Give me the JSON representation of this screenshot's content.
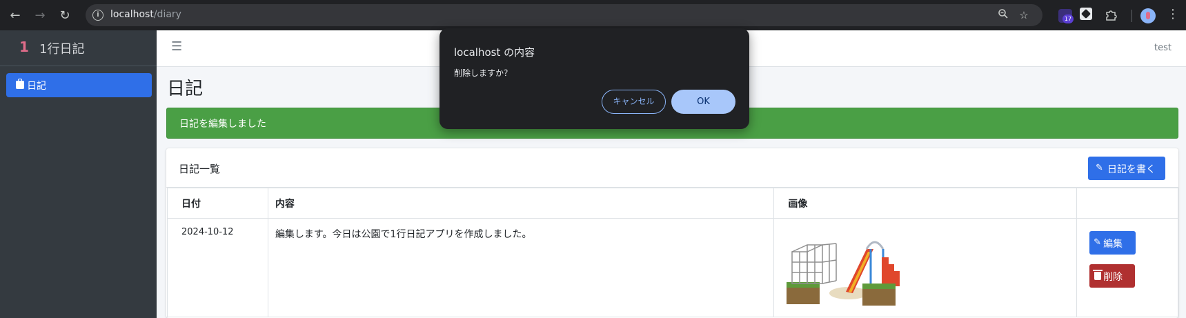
{
  "browser": {
    "url_host": "localhost",
    "url_path": "/diary",
    "extension_badge_count": "17"
  },
  "sidebar": {
    "brand_logo": "1",
    "brand_name": "1行日記",
    "items": [
      {
        "label": "日記",
        "icon": "briefcase-icon",
        "active": true
      }
    ]
  },
  "header": {
    "user": "test"
  },
  "page": {
    "title": "日記",
    "alert_message": "日記を編集しました"
  },
  "card": {
    "title": "日記一覧",
    "write_button": "日記を書く",
    "columns": [
      "日付",
      "内容",
      "画像",
      ""
    ],
    "rows": [
      {
        "date": "2024-10-12",
        "content": "編集します。今日は公園で1行日記アプリを作成しました。",
        "image": "playground-illustration",
        "edit_label": "編集",
        "delete_label": "削除"
      }
    ]
  },
  "dialog": {
    "title": "localhost の内容",
    "message": "削除しますか？",
    "cancel_label": "キャンセル",
    "ok_label": "OK"
  },
  "colors": {
    "primary": "#2f6fe8",
    "success": "#4a9f45",
    "danger": "#b03030",
    "sidebar": "#343a40",
    "dialog": "#202124"
  }
}
